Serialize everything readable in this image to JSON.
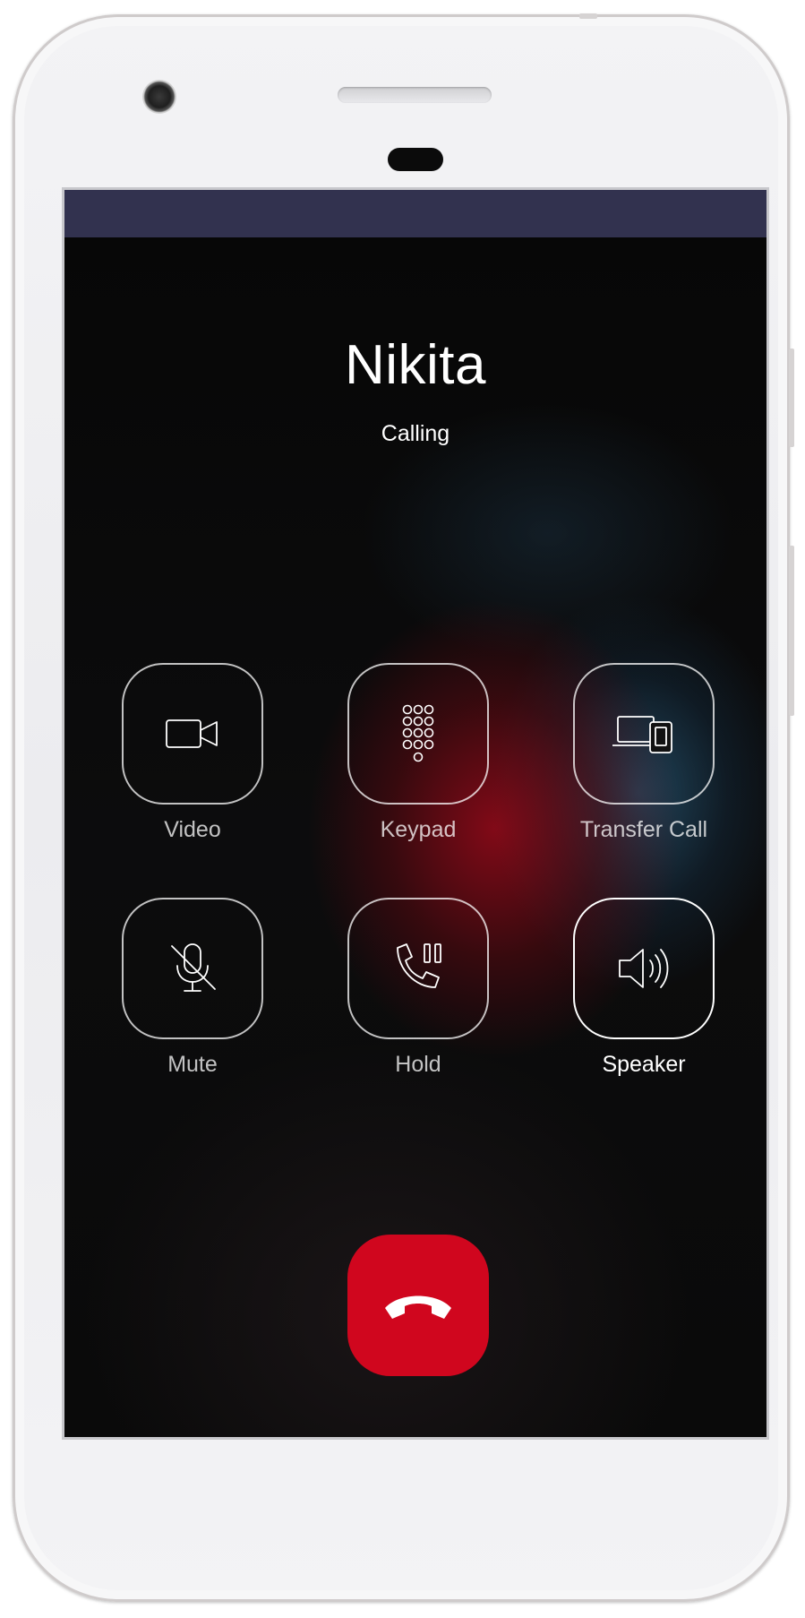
{
  "contact": {
    "name": "Nikita",
    "status": "Calling"
  },
  "controls": [
    {
      "label": "Video",
      "icon": "video-camera-icon",
      "active": false
    },
    {
      "label": "Keypad",
      "icon": "keypad-icon",
      "active": false
    },
    {
      "label": "Transfer Call",
      "icon": "transfer-devices-icon",
      "active": false
    },
    {
      "label": "Mute",
      "icon": "microphone-off-icon",
      "active": false
    },
    {
      "label": "Hold",
      "icon": "phone-pause-icon",
      "active": false
    },
    {
      "label": "Speaker",
      "icon": "speaker-icon",
      "active": true
    }
  ],
  "end_call": {
    "icon": "hang-up-icon",
    "color": "#d0061e"
  },
  "colors": {
    "status_bar": "#32324f",
    "text": "#ffffff"
  }
}
